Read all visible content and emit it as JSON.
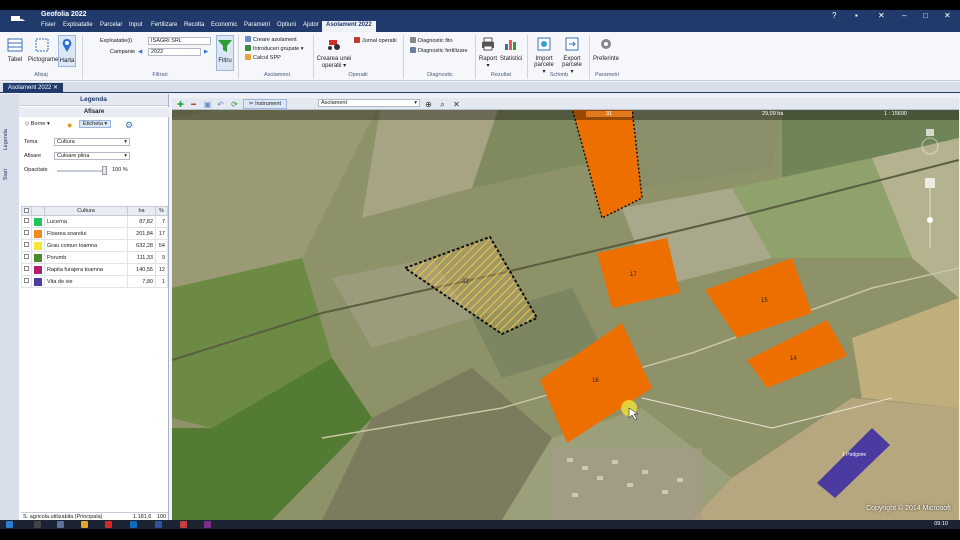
{
  "app": {
    "title": "Geofolia 2022"
  },
  "menu": [
    "Fisier",
    "Exploatatie",
    "Parcelar",
    "Input",
    "Fertilizare",
    "Recolta",
    "Economic",
    "Parametri",
    "Optiuni",
    "Ajutor"
  ],
  "menu_active": "Asolament 2022",
  "ribbon": {
    "afisaj": {
      "buttons": [
        "Tabel",
        "Pictograme",
        "Harta"
      ],
      "group": "Afisaj"
    },
    "filtrari": {
      "exploatatie_label": "Exploatatie(i)",
      "exploatatie_value": "ISAGRI SRL",
      "campanie_label": "Campanie",
      "campanie_value": "2022",
      "filter_button": "Filtru",
      "group": "Filtrari"
    },
    "asolament": {
      "items": [
        "Creare asolament",
        "Introduceri grupate",
        "Calcul SPP"
      ],
      "group": "Asolament"
    },
    "operatii": {
      "button": "Crearea unei operatii",
      "item": "Jurnal operatii",
      "group": "Operatii"
    },
    "diagnostic": {
      "items": [
        "Diagnostic fito",
        "Diagnostic fertilizare"
      ],
      "group": "Diagnostic"
    },
    "rezultat": {
      "buttons": [
        "Raport",
        "Statistici"
      ],
      "group": "Rezultat"
    },
    "schimb": {
      "buttons": [
        "Import parcele",
        "Export parcele"
      ],
      "group": "Schimb"
    },
    "parametri": {
      "buttons": [
        "Preferinte"
      ],
      "group": "Parametri"
    }
  },
  "doc_tab": "Asolament 2022",
  "left_strip": [
    "Legenda",
    "Stari"
  ],
  "legend": {
    "title": "Legenda",
    "subtitle": "Afisare",
    "borne_label": "Borne",
    "eticheta_label": "Eticheta",
    "tema_label": "Tema",
    "tema_value": "Cultura",
    "afisare_label": "Afisare",
    "afisare_value": "Culoare plina",
    "opacitate_label": "Opacitate",
    "opacitate_value": "100 %",
    "columns": [
      "Cultura",
      "ha",
      "%"
    ],
    "rows": [
      {
        "name": "Lucerna",
        "ha": "87,82",
        "pct": "7",
        "color": "#22c55e"
      },
      {
        "name": "Floarea soarelui",
        "ha": "201,84",
        "pct": "17",
        "color": "#f28a1d"
      },
      {
        "name": "Grau comun toamna",
        "ha": "632,28",
        "pct": "54",
        "color": "#f5e63a"
      },
      {
        "name": "Porumb",
        "ha": "111,33",
        "pct": "9",
        "color": "#4a8a2a"
      },
      {
        "name": "Rapita furajera toamna",
        "ha": "140,55",
        "pct": "12",
        "color": "#b01f6e"
      },
      {
        "name": "Vita de vie",
        "ha": "7,80",
        "pct": "1",
        "color": "#4b3aa0"
      }
    ],
    "footer_label": "S. agricola utilizabila (Principala)",
    "footer_ha": "1.181,6",
    "footer_pct": "100"
  },
  "map": {
    "toolbar_instrument": "Instrument",
    "layer_select": "Asolament",
    "coord_left": "31",
    "coord_area": "29,09 ha",
    "scale": "1 : 15690",
    "parcels": [
      {
        "label": "31",
        "color": "#ec6f00"
      },
      {
        "label": "17",
        "color": "#ec6f00"
      },
      {
        "label": "15",
        "color": "#ec6f00"
      },
      {
        "label": "14",
        "color": "#ec6f00"
      },
      {
        "label": "16",
        "color": "#ec6f00"
      },
      {
        "label": "32",
        "color": "#f5d34a"
      },
      {
        "label": "1 Podgorie",
        "color": "#4b3aa0"
      }
    ],
    "copyright": "Copyright © 2014 Microsoft"
  },
  "taskbar": {
    "clock": "09:10"
  }
}
